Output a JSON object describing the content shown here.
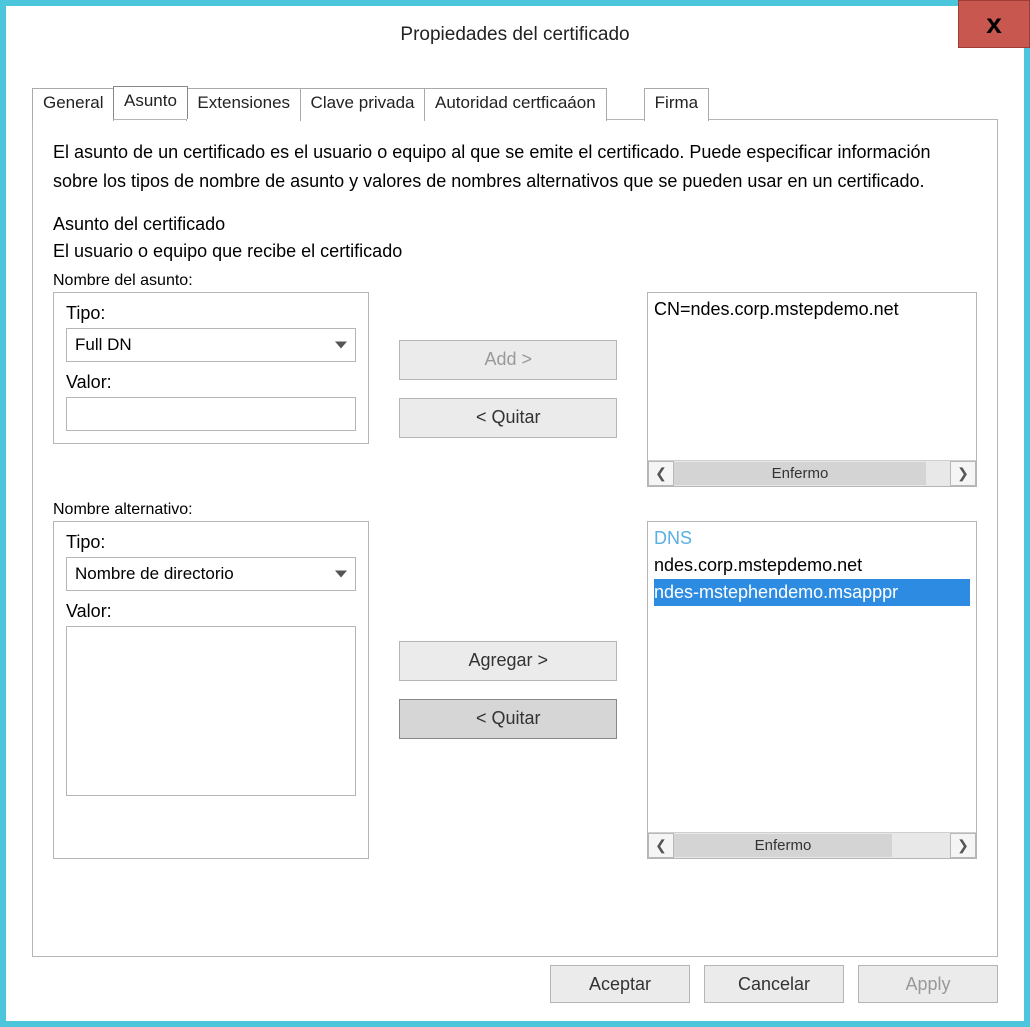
{
  "window": {
    "title": "Propiedades del certificado",
    "close_label": "x"
  },
  "tabs": {
    "general": "General",
    "asunto": "Asunto",
    "extensiones": "Extensiones",
    "clave_privada": "Clave privada",
    "autoridad": "Autoridad certficaáon",
    "firma": "Firma"
  },
  "content": {
    "intro": "El asunto de un certificado es el usuario o equipo al que se emite el certificado. Puede especificar información sobre los tipos de nombre de asunto y valores de nombres alternativos que se pueden usar en un certificado.",
    "section_heading": "Asunto del certificado",
    "section_sub": "El usuario o equipo que recibe el certificado"
  },
  "subject_name": {
    "group_label": "Nombre del asunto:",
    "type_label": "Tipo:",
    "type_value": "Full DN",
    "value_label": "Valor:",
    "value_value": "",
    "add_label": "Add >",
    "remove_label": "< Quitar",
    "list_item_0": "CN=ndes.corp.mstepdemo.net",
    "scroll_thumb": "Enfermo"
  },
  "alt_name": {
    "group_label": "Nombre alternativo:",
    "type_label": "Tipo:",
    "type_value": "Nombre de directorio",
    "value_label": "Valor:",
    "value_value": "",
    "add_label": "Agregar >",
    "remove_label": "< Quitar",
    "list_header": "DNS",
    "list_item_0": "ndes.corp.mstepdemo.net",
    "list_item_1": "ndes-mstephendemo.msapppr",
    "scroll_thumb": "Enfermo"
  },
  "footer": {
    "ok": "Aceptar",
    "cancel": "Cancelar",
    "apply": "Apply"
  }
}
